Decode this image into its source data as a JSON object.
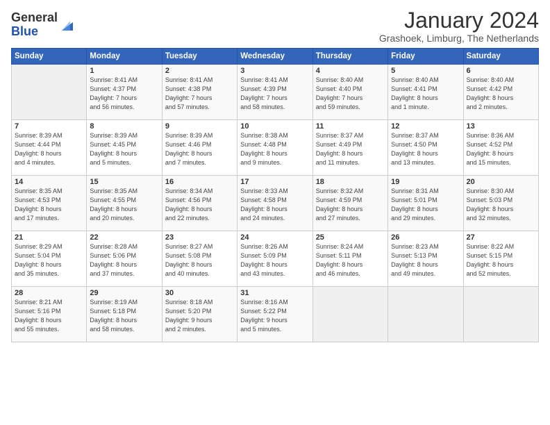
{
  "header": {
    "logo_general": "General",
    "logo_blue": "Blue",
    "month_title": "January 2024",
    "location": "Grashoek, Limburg, The Netherlands"
  },
  "columns": [
    "Sunday",
    "Monday",
    "Tuesday",
    "Wednesday",
    "Thursday",
    "Friday",
    "Saturday"
  ],
  "weeks": [
    [
      {
        "day": "",
        "info": ""
      },
      {
        "day": "1",
        "info": "Sunrise: 8:41 AM\nSunset: 4:37 PM\nDaylight: 7 hours\nand 56 minutes."
      },
      {
        "day": "2",
        "info": "Sunrise: 8:41 AM\nSunset: 4:38 PM\nDaylight: 7 hours\nand 57 minutes."
      },
      {
        "day": "3",
        "info": "Sunrise: 8:41 AM\nSunset: 4:39 PM\nDaylight: 7 hours\nand 58 minutes."
      },
      {
        "day": "4",
        "info": "Sunrise: 8:40 AM\nSunset: 4:40 PM\nDaylight: 7 hours\nand 59 minutes."
      },
      {
        "day": "5",
        "info": "Sunrise: 8:40 AM\nSunset: 4:41 PM\nDaylight: 8 hours\nand 1 minute."
      },
      {
        "day": "6",
        "info": "Sunrise: 8:40 AM\nSunset: 4:42 PM\nDaylight: 8 hours\nand 2 minutes."
      }
    ],
    [
      {
        "day": "7",
        "info": "Sunrise: 8:39 AM\nSunset: 4:44 PM\nDaylight: 8 hours\nand 4 minutes."
      },
      {
        "day": "8",
        "info": "Sunrise: 8:39 AM\nSunset: 4:45 PM\nDaylight: 8 hours\nand 5 minutes."
      },
      {
        "day": "9",
        "info": "Sunrise: 8:39 AM\nSunset: 4:46 PM\nDaylight: 8 hours\nand 7 minutes."
      },
      {
        "day": "10",
        "info": "Sunrise: 8:38 AM\nSunset: 4:48 PM\nDaylight: 8 hours\nand 9 minutes."
      },
      {
        "day": "11",
        "info": "Sunrise: 8:37 AM\nSunset: 4:49 PM\nDaylight: 8 hours\nand 11 minutes."
      },
      {
        "day": "12",
        "info": "Sunrise: 8:37 AM\nSunset: 4:50 PM\nDaylight: 8 hours\nand 13 minutes."
      },
      {
        "day": "13",
        "info": "Sunrise: 8:36 AM\nSunset: 4:52 PM\nDaylight: 8 hours\nand 15 minutes."
      }
    ],
    [
      {
        "day": "14",
        "info": "Sunrise: 8:35 AM\nSunset: 4:53 PM\nDaylight: 8 hours\nand 17 minutes."
      },
      {
        "day": "15",
        "info": "Sunrise: 8:35 AM\nSunset: 4:55 PM\nDaylight: 8 hours\nand 20 minutes."
      },
      {
        "day": "16",
        "info": "Sunrise: 8:34 AM\nSunset: 4:56 PM\nDaylight: 8 hours\nand 22 minutes."
      },
      {
        "day": "17",
        "info": "Sunrise: 8:33 AM\nSunset: 4:58 PM\nDaylight: 8 hours\nand 24 minutes."
      },
      {
        "day": "18",
        "info": "Sunrise: 8:32 AM\nSunset: 4:59 PM\nDaylight: 8 hours\nand 27 minutes."
      },
      {
        "day": "19",
        "info": "Sunrise: 8:31 AM\nSunset: 5:01 PM\nDaylight: 8 hours\nand 29 minutes."
      },
      {
        "day": "20",
        "info": "Sunrise: 8:30 AM\nSunset: 5:03 PM\nDaylight: 8 hours\nand 32 minutes."
      }
    ],
    [
      {
        "day": "21",
        "info": "Sunrise: 8:29 AM\nSunset: 5:04 PM\nDaylight: 8 hours\nand 35 minutes."
      },
      {
        "day": "22",
        "info": "Sunrise: 8:28 AM\nSunset: 5:06 PM\nDaylight: 8 hours\nand 37 minutes."
      },
      {
        "day": "23",
        "info": "Sunrise: 8:27 AM\nSunset: 5:08 PM\nDaylight: 8 hours\nand 40 minutes."
      },
      {
        "day": "24",
        "info": "Sunrise: 8:26 AM\nSunset: 5:09 PM\nDaylight: 8 hours\nand 43 minutes."
      },
      {
        "day": "25",
        "info": "Sunrise: 8:24 AM\nSunset: 5:11 PM\nDaylight: 8 hours\nand 46 minutes."
      },
      {
        "day": "26",
        "info": "Sunrise: 8:23 AM\nSunset: 5:13 PM\nDaylight: 8 hours\nand 49 minutes."
      },
      {
        "day": "27",
        "info": "Sunrise: 8:22 AM\nSunset: 5:15 PM\nDaylight: 8 hours\nand 52 minutes."
      }
    ],
    [
      {
        "day": "28",
        "info": "Sunrise: 8:21 AM\nSunset: 5:16 PM\nDaylight: 8 hours\nand 55 minutes."
      },
      {
        "day": "29",
        "info": "Sunrise: 8:19 AM\nSunset: 5:18 PM\nDaylight: 8 hours\nand 58 minutes."
      },
      {
        "day": "30",
        "info": "Sunrise: 8:18 AM\nSunset: 5:20 PM\nDaylight: 9 hours\nand 2 minutes."
      },
      {
        "day": "31",
        "info": "Sunrise: 8:16 AM\nSunset: 5:22 PM\nDaylight: 9 hours\nand 5 minutes."
      },
      {
        "day": "",
        "info": ""
      },
      {
        "day": "",
        "info": ""
      },
      {
        "day": "",
        "info": ""
      }
    ]
  ]
}
